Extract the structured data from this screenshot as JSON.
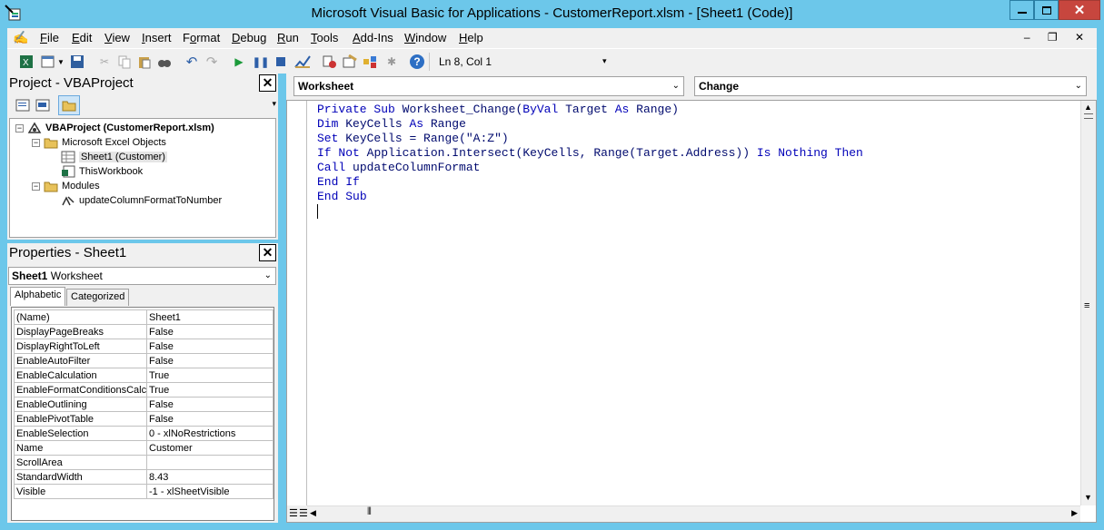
{
  "window": {
    "title": "Microsoft Visual Basic for Applications - CustomerReport.xlsm - [Sheet1 (Code)]",
    "icon": "vba-app-icon"
  },
  "menu": {
    "items": [
      "File",
      "Edit",
      "View",
      "Insert",
      "Format",
      "Debug",
      "Run",
      "Tools",
      "Add-Ins",
      "Window",
      "Help"
    ],
    "mnemonics": [
      "F",
      "E",
      "V",
      "I",
      "o",
      "D",
      "R",
      "T",
      "A",
      "W",
      "H"
    ]
  },
  "toolbar": {
    "cursor_position": "Ln 8, Col 1",
    "icons": [
      "excel-icon",
      "insert-module-icon",
      "save-icon",
      "cut-icon",
      "copy-icon",
      "paste-icon",
      "find-icon",
      "undo-icon",
      "redo-icon",
      "run-icon",
      "break-icon",
      "reset-icon",
      "design-mode-icon",
      "project-explorer-icon",
      "properties-icon",
      "object-browser-icon",
      "toolbox-icon",
      "help-icon"
    ]
  },
  "project_pane": {
    "title": "Project - VBAProject",
    "tree": [
      {
        "label": "VBAProject (CustomerReport.xlsm)",
        "level": 0,
        "bold": true,
        "icon": "vba-project-icon"
      },
      {
        "label": "Microsoft Excel Objects",
        "level": 1,
        "icon": "folder-icon"
      },
      {
        "label": "Sheet1 (Customer)",
        "level": 2,
        "icon": "sheet-icon",
        "selected": true
      },
      {
        "label": "ThisWorkbook",
        "level": 2,
        "icon": "workbook-icon"
      },
      {
        "label": "Modules",
        "level": 1,
        "icon": "folder-icon"
      },
      {
        "label": "updateColumnFormatToNumber",
        "level": 2,
        "icon": "module-icon"
      }
    ]
  },
  "properties_pane": {
    "title": "Properties - Sheet1",
    "object_name": "Sheet1",
    "object_type": "Worksheet",
    "tabs": [
      "Alphabetic",
      "Categorized"
    ],
    "active_tab": "Alphabetic",
    "rows": [
      {
        "name": "(Name)",
        "value": "Sheet1"
      },
      {
        "name": "DisplayPageBreaks",
        "value": "False"
      },
      {
        "name": "DisplayRightToLeft",
        "value": "False"
      },
      {
        "name": "EnableAutoFilter",
        "value": "False"
      },
      {
        "name": "EnableCalculation",
        "value": "True"
      },
      {
        "name": "EnableFormatConditionsCalcul",
        "value": "True"
      },
      {
        "name": "EnableOutlining",
        "value": "False"
      },
      {
        "name": "EnablePivotTable",
        "value": "False"
      },
      {
        "name": "EnableSelection",
        "value": "0 - xlNoRestrictions"
      },
      {
        "name": "Name",
        "value": "Customer"
      },
      {
        "name": "ScrollArea",
        "value": ""
      },
      {
        "name": "StandardWidth",
        "value": "8.43"
      },
      {
        "name": "Visible",
        "value": "-1 - xlSheetVisible"
      }
    ]
  },
  "code_pane": {
    "object_combo": "Worksheet",
    "procedure_combo": "Change",
    "lines": [
      "Private Sub Worksheet_Change(ByVal Target As Range)",
      "Dim KeyCells As Range",
      "Set KeyCells = Range(\"A:Z\")",
      "If Not Application.Intersect(KeyCells, Range(Target.Address)) Is Nothing Then",
      "Call updateColumnFormat",
      "End If",
      "End Sub",
      ""
    ]
  },
  "colors": {
    "titlebar": "#6cc7ea",
    "close_button": "#c7463e",
    "keyword": "#0000b8",
    "code_text": "#000a6e"
  }
}
